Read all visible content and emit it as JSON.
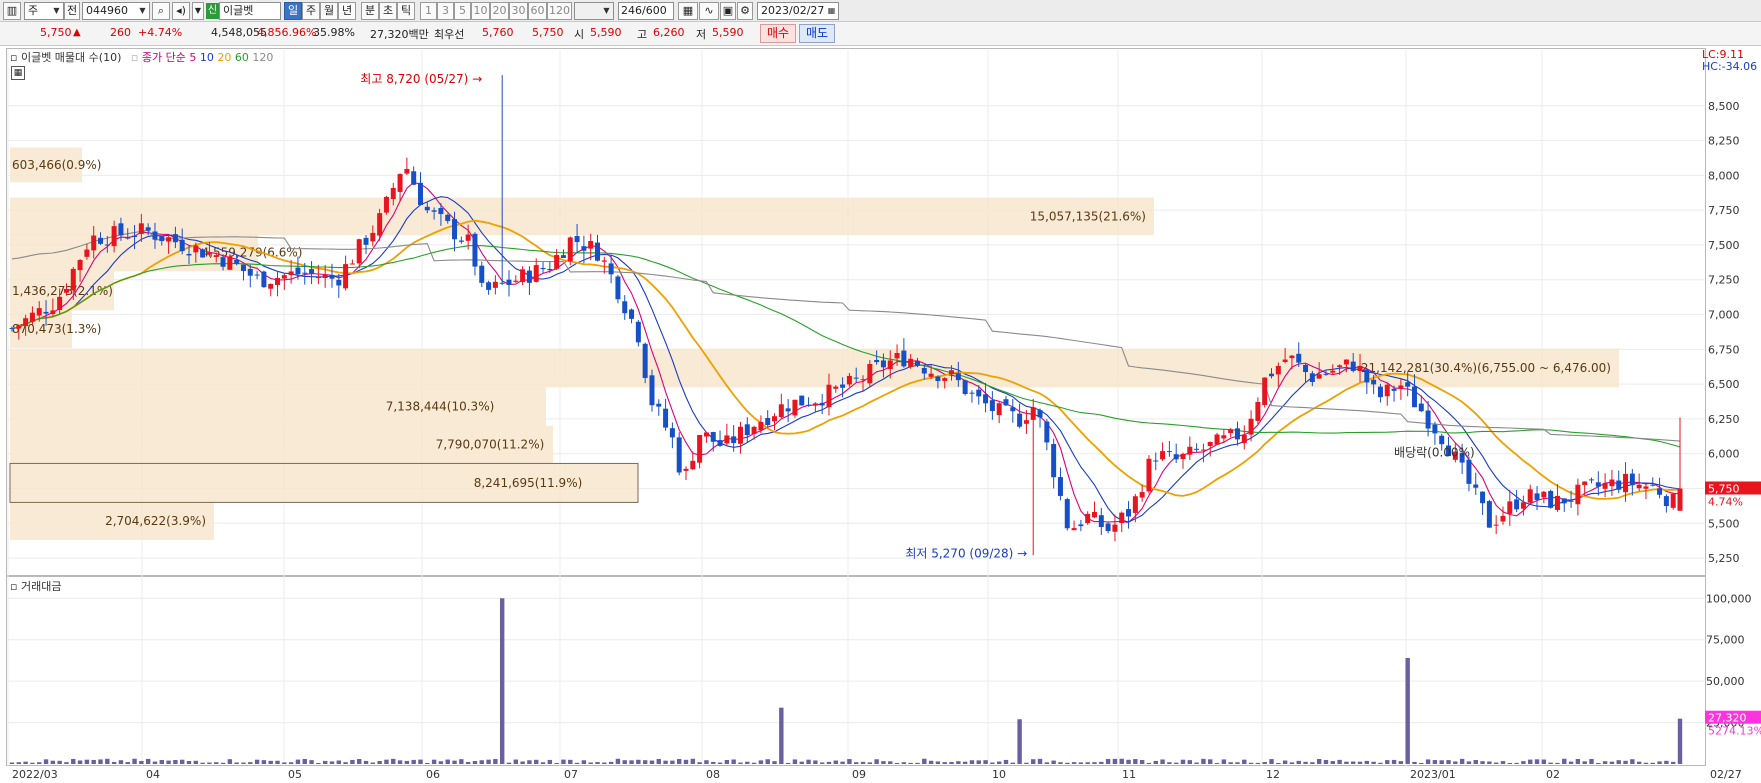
{
  "toolbar": {
    "period_type": "주",
    "compare_mode": "전",
    "stock_code": "044960",
    "badge": "신",
    "stock_name": "이글벳",
    "periods": [
      "일",
      "주",
      "월",
      "년",
      "분",
      "초",
      "틱"
    ],
    "minute_options": [
      "1",
      "3",
      "5",
      "10",
      "20",
      "30",
      "60",
      "120"
    ],
    "count_current": "246",
    "count_total": "/600",
    "date": "2023/02/27"
  },
  "quote": {
    "price": "5,750",
    "up_mark": "▲",
    "change": "260",
    "change_pct": "+4.74%",
    "volume": "4,548,055",
    "volume_ratio": "4,856.96%",
    "turnover": "35.98%",
    "amount": "27,320백만",
    "best_ask_label": "최우선",
    "best_ask": "5,760",
    "best_bid": "5,750",
    "open_label": "시",
    "open": "5,590",
    "high_label": "고",
    "high": "6,260",
    "low_label": "저",
    "low": "5,590",
    "buy_label": "매수",
    "sell_label": "매도"
  },
  "legend": {
    "volume_profile": "이글벳 매물대 수(10)",
    "ma_label": "종가 단순",
    "ma_periods": [
      "5",
      "10",
      "20",
      "60",
      "120"
    ],
    "ma_colors": [
      "#e0007a",
      "#1a3cc8",
      "#f0a000",
      "#2aa02a",
      "#8a8a8a"
    ]
  },
  "right_info": {
    "lc": "LC:9.11",
    "hc": "HC:-34.06",
    "price_tag": "5,750",
    "pct_tag": "4.74%",
    "vol_tag": "27,320",
    "vol_pct_tag": "5274.13%"
  },
  "volume_panel_title": "거래대금",
  "annotations": {
    "high": "최고 8,720 (05/27)",
    "low": "최저 5,270 (09/28)",
    "dividend": "배당락(0.00%)"
  },
  "colors": {
    "up": "#e8141e",
    "down": "#1650c8",
    "profile": "#f7e6cc",
    "volbar": "#6a60a0"
  },
  "chart_data": [
    {
      "type": "candlestick",
      "title": "이글벳",
      "ylim": [
        5150,
        8800
      ],
      "y_ticks": [
        "8,500",
        "8,250",
        "8,000",
        "7,750",
        "7,500",
        "7,250",
        "7,000",
        "6,750",
        "6,500",
        "6,250",
        "6,000",
        "5,750",
        "5,500",
        "5,250"
      ],
      "x_ticks": [
        "2022/03",
        "04",
        "05",
        "06",
        "07",
        "08",
        "09",
        "10",
        "11",
        "12",
        "2023/01",
        "02",
        "02/27"
      ],
      "volume_profile": [
        {
          "price_low": 7950,
          "price_high": 8200,
          "label": "603,466(0.9%)"
        },
        {
          "price_low": 7570,
          "price_high": 7840,
          "label": "15,057,135(21.6%)"
        },
        {
          "price_low": 7310,
          "price_high": 7580,
          "label": "4,559,279(6.6%)"
        },
        {
          "price_low": 7030,
          "price_high": 7310,
          "label": "1,436,273(2.1%)"
        },
        {
          "price_low": 6760,
          "price_high": 7030,
          "label": "870,473(1.3%)"
        },
        {
          "price_low": 6476,
          "price_high": 6755,
          "label": "21,142,281(30.4%)(6,755.00 ~ 6,476.00)"
        },
        {
          "price_low": 6200,
          "price_high": 6476,
          "label": "7,138,444(10.3%)"
        },
        {
          "price_low": 5930,
          "price_high": 6200,
          "label": "7,790,070(11.2%)"
        },
        {
          "price_low": 5650,
          "price_high": 5930,
          "label": "8,241,695(11.9%)"
        },
        {
          "price_low": 5380,
          "price_high": 5650,
          "label": "2,704,622(3.9%)"
        }
      ],
      "key_prices": [
        {
          "date": "2022/05/27",
          "high": 8720
        },
        {
          "date": "2022/09/28",
          "low": 5270
        },
        {
          "date": "2023/02/27",
          "open": 5590,
          "high": 6260,
          "low": 5590,
          "close": 5750
        }
      ],
      "ma_trend_samples": {
        "ma120": [
          7900,
          7750,
          7600,
          7350,
          7200,
          7050,
          6950,
          6800,
          6550,
          6250,
          6150,
          6080,
          5980
        ],
        "ma60": [
          7400,
          7250,
          7300,
          7400,
          7100,
          6600,
          6550,
          6400,
          6250,
          6200,
          6150,
          6100,
          5900
        ]
      }
    },
    {
      "type": "bar",
      "title": "거래대금",
      "y_ticks": [
        "100,000",
        "75,000",
        "50,000",
        "25,000"
      ],
      "ylim": [
        0,
        105000
      ],
      "spikes": [
        {
          "date": "2022/05/27",
          "value": 100000
        },
        {
          "date": "2022/07/01",
          "value": 34000
        },
        {
          "date": "2022/08/17",
          "value": 27000
        },
        {
          "date": "2022/11/15",
          "value": 64000
        },
        {
          "date": "2023/02/27",
          "value": 27320
        }
      ]
    }
  ]
}
